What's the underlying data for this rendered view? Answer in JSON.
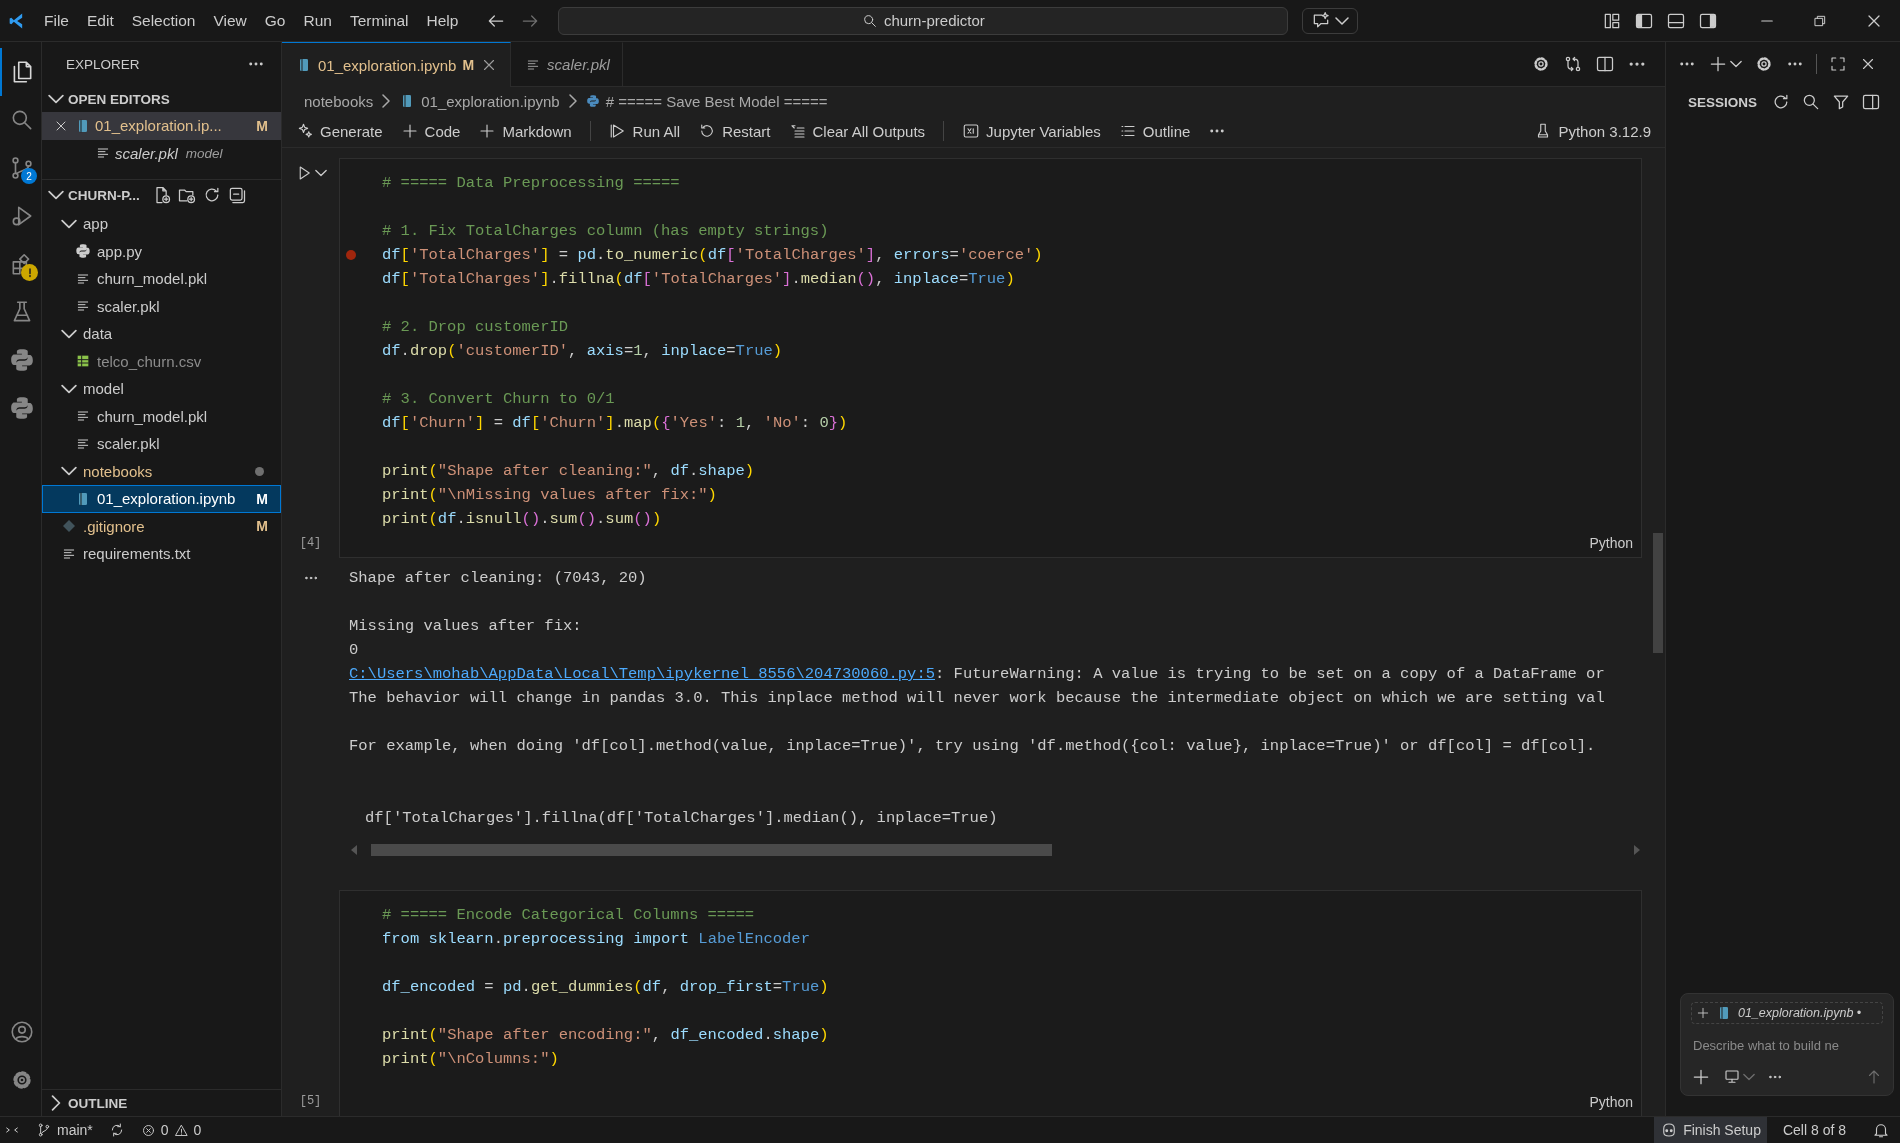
{
  "title_bar": {
    "menu": [
      "File",
      "Edit",
      "Selection",
      "View",
      "Go",
      "Run",
      "Terminal",
      "Help"
    ],
    "search": "churn-predictor"
  },
  "activity_bar": {
    "top": [
      {
        "kind": "explorer",
        "selected": true
      },
      {
        "kind": "search",
        "selected": false
      },
      {
        "kind": "source-control",
        "selected": false,
        "badge": "2"
      },
      {
        "kind": "run",
        "selected": false
      },
      {
        "kind": "extensions",
        "selected": false,
        "warning": true
      },
      {
        "kind": "testing",
        "selected": false
      },
      {
        "kind": "python",
        "selected": false
      },
      {
        "kind": "python",
        "selected": false
      }
    ],
    "bottom": [
      {
        "kind": "account"
      },
      {
        "kind": "settings"
      }
    ]
  },
  "sidebar": {
    "title": "EXPLORER",
    "open_editors": {
      "title": "OPEN EDITORS",
      "expanded": true,
      "items": [
        {
          "label": "01_exploration.ip...",
          "kind": "notebook",
          "badge": "M",
          "selected": true,
          "preview": false
        },
        {
          "label": "scaler.pkl",
          "kind": "file",
          "description": "model",
          "selected": false,
          "preview": true
        }
      ]
    },
    "folder": {
      "title": "CHURN-P...",
      "expanded": true,
      "items": [
        {
          "label": "app",
          "kind": "folder",
          "expanded": true,
          "modified": false,
          "ignored": false,
          "selected": false,
          "children": [
            {
              "label": "app.py",
              "kind": "python",
              "modified": false,
              "ignored": false,
              "selected": false
            },
            {
              "label": "churn_model.pkl",
              "kind": "file",
              "modified": false,
              "ignored": false,
              "selected": false
            },
            {
              "label": "scaler.pkl",
              "kind": "file",
              "modified": false,
              "ignored": false,
              "selected": false
            }
          ]
        },
        {
          "label": "data",
          "kind": "folder",
          "expanded": true,
          "modified": false,
          "ignored": false,
          "selected": false,
          "children": [
            {
              "label": "telco_churn.csv",
              "kind": "csv",
              "modified": false,
              "ignored": true,
              "selected": false
            }
          ]
        },
        {
          "label": "model",
          "kind": "folder",
          "expanded": true,
          "modified": false,
          "ignored": false,
          "selected": false,
          "children": [
            {
              "label": "churn_model.pkl",
              "kind": "file",
              "modified": false,
              "ignored": false,
              "selected": false
            },
            {
              "label": "scaler.pkl",
              "kind": "file",
              "modified": false,
              "ignored": false,
              "selected": false
            }
          ]
        },
        {
          "label": "notebooks",
          "kind": "folder",
          "expanded": true,
          "modified": true,
          "ignored": false,
          "selected": false,
          "children": [
            {
              "label": "01_exploration.ipynb",
              "kind": "notebook",
              "modified": false,
              "ignored": false,
              "badge": "M",
              "selected": true
            }
          ]
        },
        {
          "label": ".gitignore",
          "kind": "git",
          "modified": true,
          "ignored": false,
          "badge": "M",
          "selected": false
        },
        {
          "label": "requirements.txt",
          "kind": "file",
          "modified": false,
          "ignored": false,
          "selected": false
        }
      ]
    },
    "outline": {
      "title": "OUTLINE",
      "expanded": false
    }
  },
  "tabs": [
    {
      "label": "01_exploration.ipynb",
      "kind": "notebook",
      "badge": "M",
      "selected": true,
      "preview": false
    },
    {
      "label": "scaler.pkl",
      "kind": "file",
      "selected": false,
      "preview": true
    }
  ],
  "breadcrumb": [
    {
      "label": "notebooks",
      "kind": "folder"
    },
    {
      "label": "01_exploration.ipynb",
      "kind": "notebook"
    },
    {
      "label": "# ===== Save Best Model =====",
      "kind": "python"
    }
  ],
  "toolbar": {
    "groups": [
      [
        {
          "label": "Generate",
          "kind": "generate"
        },
        {
          "label": "Code",
          "kind": "add"
        },
        {
          "label": "Markdown",
          "kind": "add"
        }
      ],
      [
        {
          "label": "Run All",
          "kind": "run-all"
        },
        {
          "label": "Restart",
          "kind": "restart"
        },
        {
          "label": "Clear All Outputs",
          "kind": "clear"
        }
      ],
      [
        {
          "label": "Jupyter Variables",
          "kind": "variables"
        },
        {
          "label": "Outline",
          "kind": "outline"
        },
        {
          "kind": "more"
        }
      ]
    ],
    "kernel": "Python 3.12.9"
  },
  "cells": [
    {
      "execution_count": "[4]",
      "language": "Python",
      "run_button": true,
      "blocks": [
        [
          {
            "text": "# ===== Data Preprocessing =====",
            "breakpoint": false
          }
        ],
        [
          {
            "text": "# 1. Fix TotalCharges column (has empty strings)",
            "breakpoint": false
          },
          {
            "text": "df['TotalCharges'] = pd.to_numeric(df['TotalCharges'], errors='coerce')",
            "breakpoint": true
          },
          {
            "text": "df['TotalCharges'].fillna(df['TotalCharges'].median(), inplace=True)",
            "breakpoint": false
          }
        ],
        [
          {
            "text": "# 2. Drop customerID",
            "breakpoint": false
          },
          {
            "text": "df.drop('customerID', axis=1, inplace=True)",
            "breakpoint": false
          }
        ],
        [
          {
            "text": "# 3. Convert Churn to 0/1",
            "breakpoint": false
          },
          {
            "text": "df['Churn'] = df['Churn'].map({'Yes': 1, 'No': 0})",
            "breakpoint": false
          }
        ],
        [
          {
            "text": "print(\"Shape after cleaning:\", df.shape)",
            "breakpoint": false
          },
          {
            "text": "print(\"\\nMissing values after fix:\")",
            "breakpoint": false
          },
          {
            "text": "print(df.isnull().sum().sum())",
            "breakpoint": false
          }
        ]
      ],
      "output": {
        "blocks": [
          {
            "kind": "text",
            "lines": [
              {
                "text": "Shape after cleaning: (7043, 20)"
              }
            ]
          },
          {
            "kind": "text",
            "lines": [
              {
                "text": "Missing values after fix:"
              },
              {
                "text": "0"
              },
              {
                "link": "C:\\Users\\mohab\\AppData\\Local\\Temp\\ipykernel_8556\\204730060.py:5",
                "text": ": FutureWarning: A value is trying to be set on a copy of a DataFrame or"
              },
              {
                "text": "The behavior will change in pandas 3.0. This inplace method will never work because the intermediate object on which we are setting val"
              }
            ]
          },
          {
            "kind": "text",
            "lines": [
              {
                "text": "For example, when doing 'df[col].method(value, inplace=True)', try using 'df.method({col: value}, inplace=True)' or df[col] = df[col]."
              }
            ]
          },
          {
            "kind": "source",
            "lines": [
              {
                "text": "df['TotalCharges'].fillna(df['TotalCharges'].median(), inplace=True)"
              }
            ]
          }
        ]
      }
    },
    {
      "execution_count": "[5]",
      "language": "Python",
      "run_button": false,
      "blocks": [
        [
          {
            "text": "# ===== Encode Categorical Columns =====",
            "breakpoint": false
          },
          {
            "text": "from sklearn.preprocessing import LabelEncoder",
            "breakpoint": false
          }
        ],
        [
          {
            "text": "df_encoded = pd.get_dummies(df, drop_first=True)",
            "breakpoint": false
          }
        ],
        [
          {
            "text": "print(\"Shape after encoding:\", df_encoded.shape)",
            "breakpoint": false
          },
          {
            "text": "print(\"\\nColumns:\")",
            "breakpoint": false
          }
        ]
      ]
    }
  ],
  "right_panel": {
    "title": "SESSIONS",
    "chat": {
      "context": "01_exploration.ipynb •",
      "placeholder": "Describe what to build ne"
    }
  },
  "status_bar": {
    "branch": "main*",
    "errors": "0",
    "warnings": "0",
    "right": [
      {
        "label": "Finish Setup",
        "kind": "copilot",
        "highlighted": true
      },
      {
        "label": "Cell 8 of 8",
        "kind": "text",
        "highlighted": false
      }
    ]
  }
}
